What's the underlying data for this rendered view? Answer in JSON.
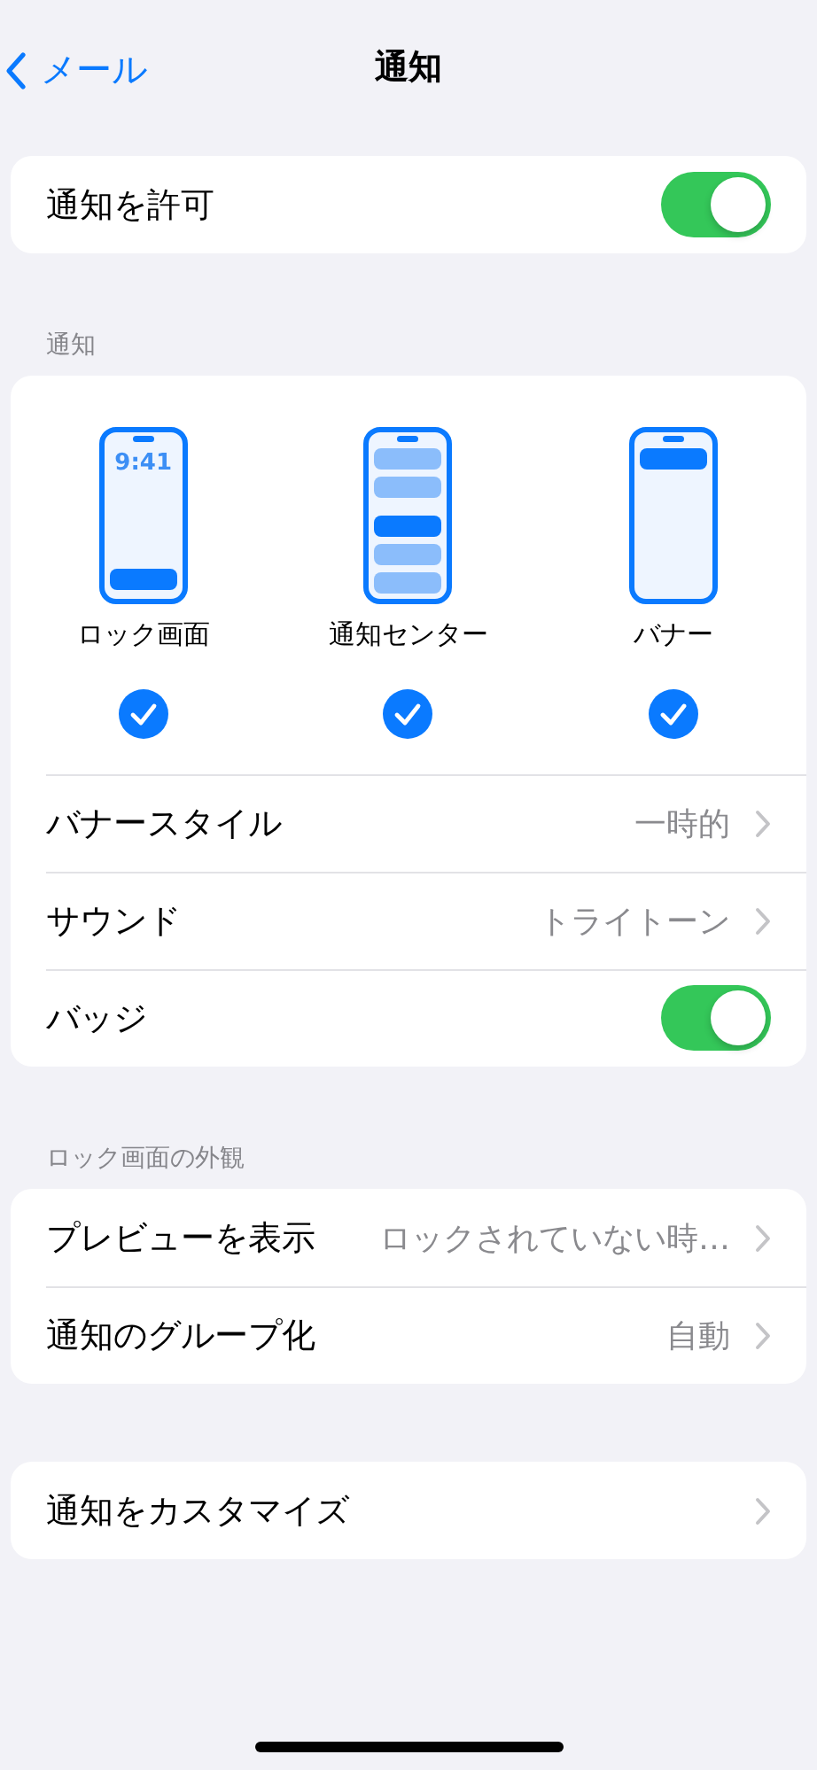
{
  "nav": {
    "back_label": "メール",
    "title": "通知"
  },
  "allow": {
    "label": "通知を許可",
    "on": true
  },
  "sections": [
    {
      "header": "通知",
      "styles": [
        {
          "kind": "lockscreen",
          "label": "ロック画面",
          "time": "9:41",
          "checked": true
        },
        {
          "kind": "center",
          "label": "通知センター",
          "checked": true
        },
        {
          "kind": "banner",
          "label": "バナー",
          "checked": true
        }
      ],
      "rows": [
        {
          "kind": "link",
          "label": "バナースタイル",
          "value": "一時的"
        },
        {
          "kind": "link",
          "label": "サウンド",
          "value": "トライトーン"
        },
        {
          "kind": "toggle",
          "label": "バッジ",
          "on": true
        }
      ]
    },
    {
      "header": "ロック画面の外観",
      "rows": [
        {
          "kind": "link",
          "label": "プレビューを表示",
          "value": "ロックされていない時…"
        },
        {
          "kind": "link",
          "label": "通知のグループ化",
          "value": "自動"
        }
      ]
    },
    {
      "rows": [
        {
          "kind": "link",
          "label": "通知をカスタマイズ"
        }
      ]
    }
  ]
}
